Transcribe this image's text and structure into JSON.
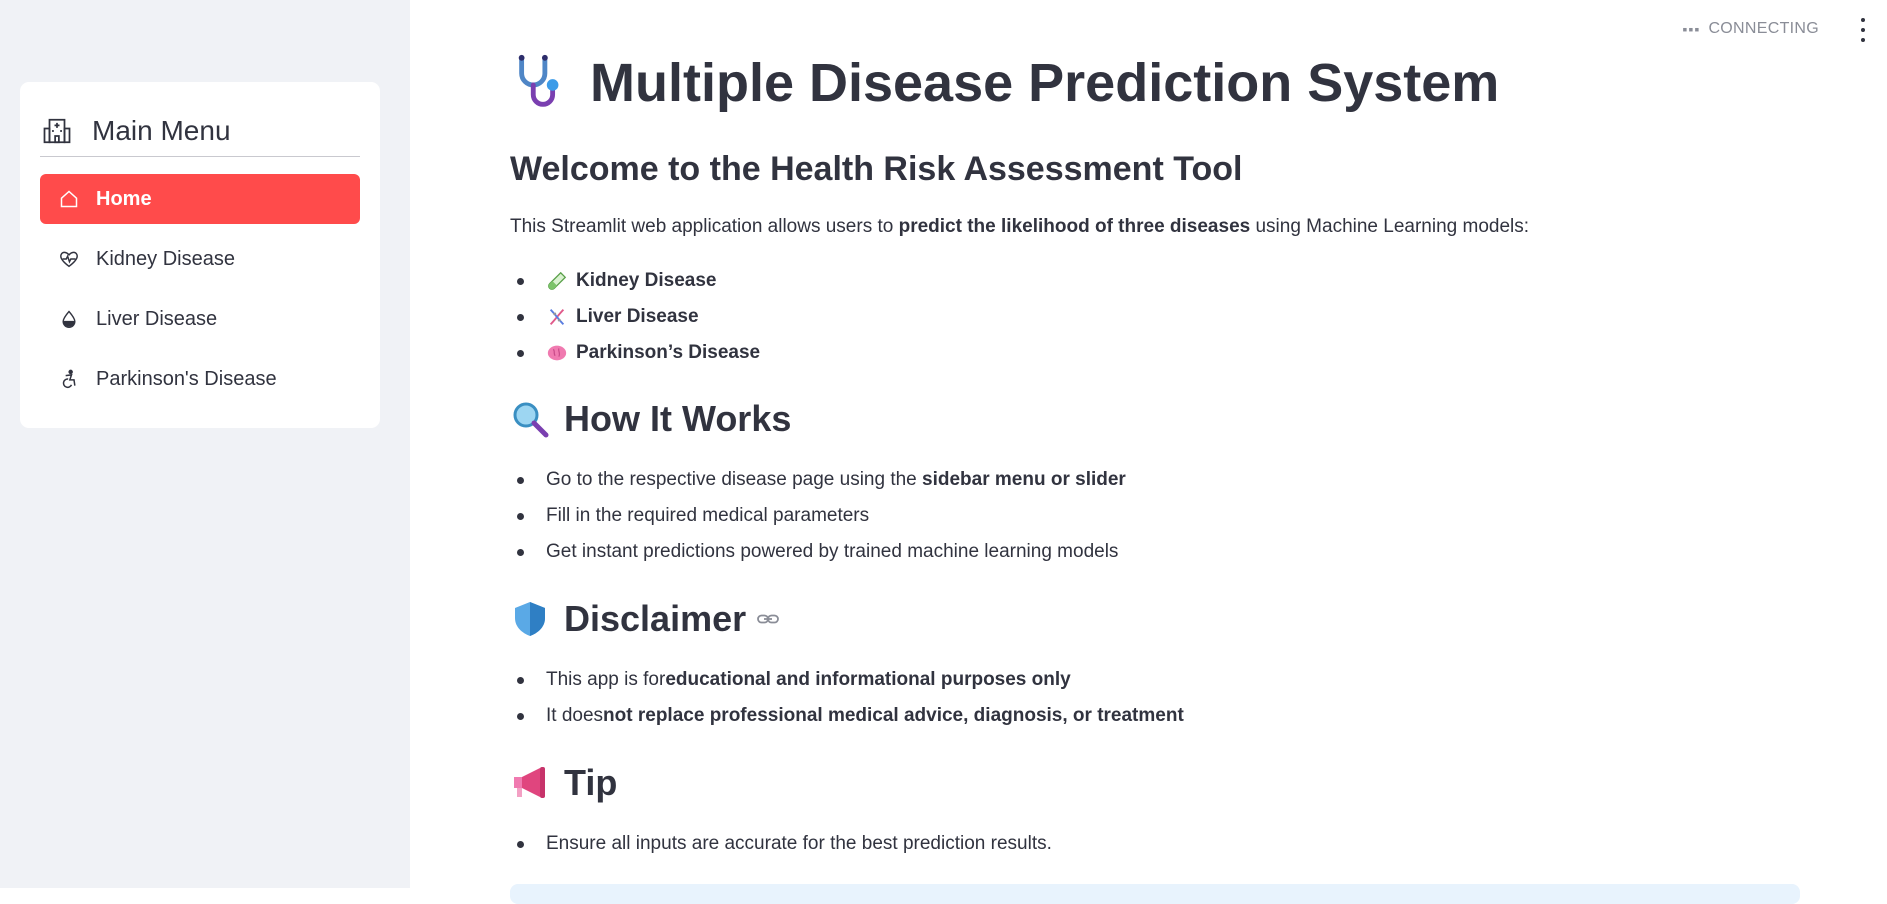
{
  "sidebar": {
    "menu_title": "Main Menu",
    "menu_icon": "hospital-icon",
    "items": [
      {
        "label": "Home",
        "icon": "house-icon",
        "active": true
      },
      {
        "label": "Kidney Disease",
        "icon": "heart-pulse-icon",
        "active": false
      },
      {
        "label": "Liver Disease",
        "icon": "droplet-half-icon",
        "active": false
      },
      {
        "label": "Parkinson's Disease",
        "icon": "accessibility-icon",
        "active": false
      }
    ]
  },
  "header": {
    "status": "CONNECTING",
    "menu_icon": "kebab-menu-icon"
  },
  "main": {
    "title": "Multiple Disease Prediction System",
    "title_icon": "stethoscope-icon",
    "subtitle": "Welcome to the Health Risk Assessment Tool",
    "intro_prefix": "This Streamlit web application allows users to ",
    "intro_bold": "predict the likelihood of three diseases",
    "intro_suffix": " using Machine Learning models:",
    "diseases": [
      {
        "label": "Kidney Disease",
        "icon": "test-tube-icon"
      },
      {
        "label": "Liver Disease",
        "icon": "dna-icon"
      },
      {
        "label": "Parkinson’s Disease",
        "icon": "brain-icon"
      }
    ],
    "how_title": "How It Works",
    "how_icon": "magnifier-icon",
    "how_items": [
      {
        "prefix": "Go to the respective disease page using the ",
        "bold": "sidebar menu or slider",
        "suffix": ""
      },
      {
        "prefix": "Fill in the required medical parameters",
        "bold": "",
        "suffix": ""
      },
      {
        "prefix": "Get instant predictions powered by trained machine learning models",
        "bold": "",
        "suffix": ""
      }
    ],
    "disclaimer_title": "Disclaimer",
    "disclaimer_icon": "shield-icon",
    "disclaimer_items": [
      {
        "prefix": "This app is for ",
        "bold": "educational and informational purposes only",
        "suffix": ""
      },
      {
        "prefix": "It does ",
        "bold": "not replace professional medical advice, diagnosis, or treatment",
        "suffix": ""
      }
    ],
    "tip_title": "Tip",
    "tip_icon": "megaphone-icon",
    "tip_items": [
      {
        "prefix": "Ensure all inputs are accurate for the best prediction results.",
        "bold": "",
        "suffix": ""
      }
    ]
  },
  "colors": {
    "accent": "#ff4b4b",
    "sidebar_bg": "#f0f2f6",
    "text": "#31333f",
    "info_bg": "#e8f3fd"
  }
}
